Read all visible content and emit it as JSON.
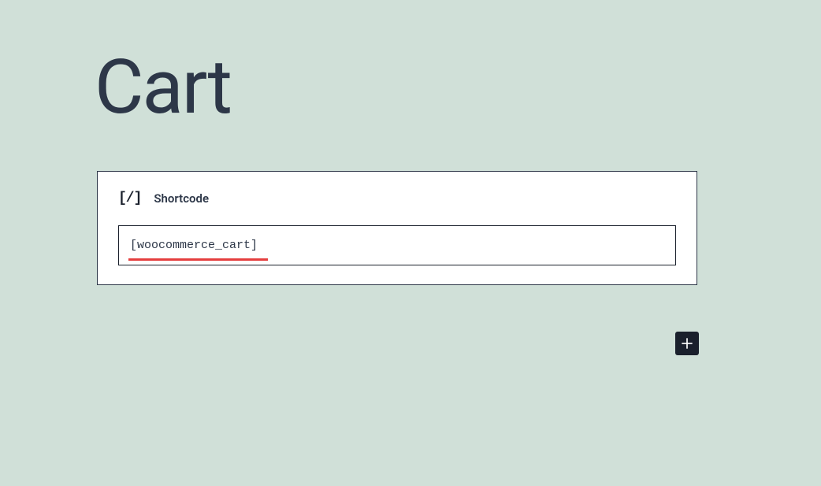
{
  "page": {
    "title": "Cart"
  },
  "block": {
    "icon_text": "[/]",
    "label": "Shortcode",
    "input_value": "[woocommerce_cart]"
  }
}
